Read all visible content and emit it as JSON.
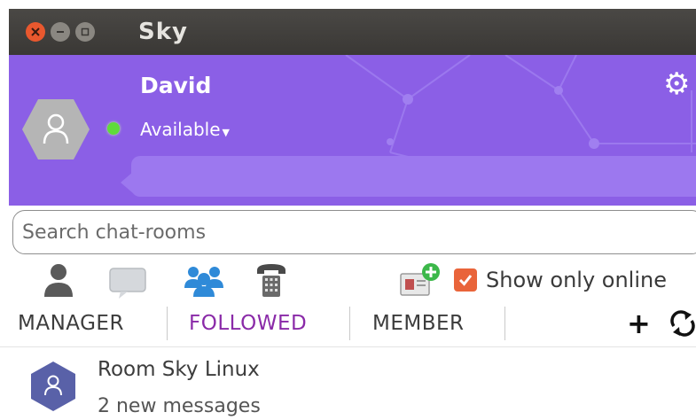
{
  "window": {
    "title": "Sky",
    "controls": [
      "close-icon",
      "minimize-icon",
      "maximize-icon"
    ]
  },
  "profile": {
    "name": "David",
    "status": "Available",
    "status_color": "#5fdc3a",
    "mood_placeholder": "",
    "header_color": "#8b5fe6"
  },
  "search": {
    "placeholder": "Search chat-rooms",
    "value": ""
  },
  "toolbar": {
    "icons": [
      "person-icon",
      "chat-bubble-icon",
      "group-icon",
      "telephone-icon",
      "add-contact-icon"
    ],
    "show_online_label": "Show only online",
    "show_online_checked": true,
    "checkbox_color": "#e9643a"
  },
  "tabs": {
    "items": [
      {
        "label": "MANAGER",
        "active": false
      },
      {
        "label": "FOLLOWED",
        "active": true
      },
      {
        "label": "MEMBER",
        "active": false
      }
    ],
    "active_color": "#8a2aa8",
    "add_icon": "plus-icon",
    "refresh_icon": "refresh-icon"
  },
  "rooms": [
    {
      "name": "Room Sky Linux",
      "subtitle": "2 new messages"
    }
  ]
}
